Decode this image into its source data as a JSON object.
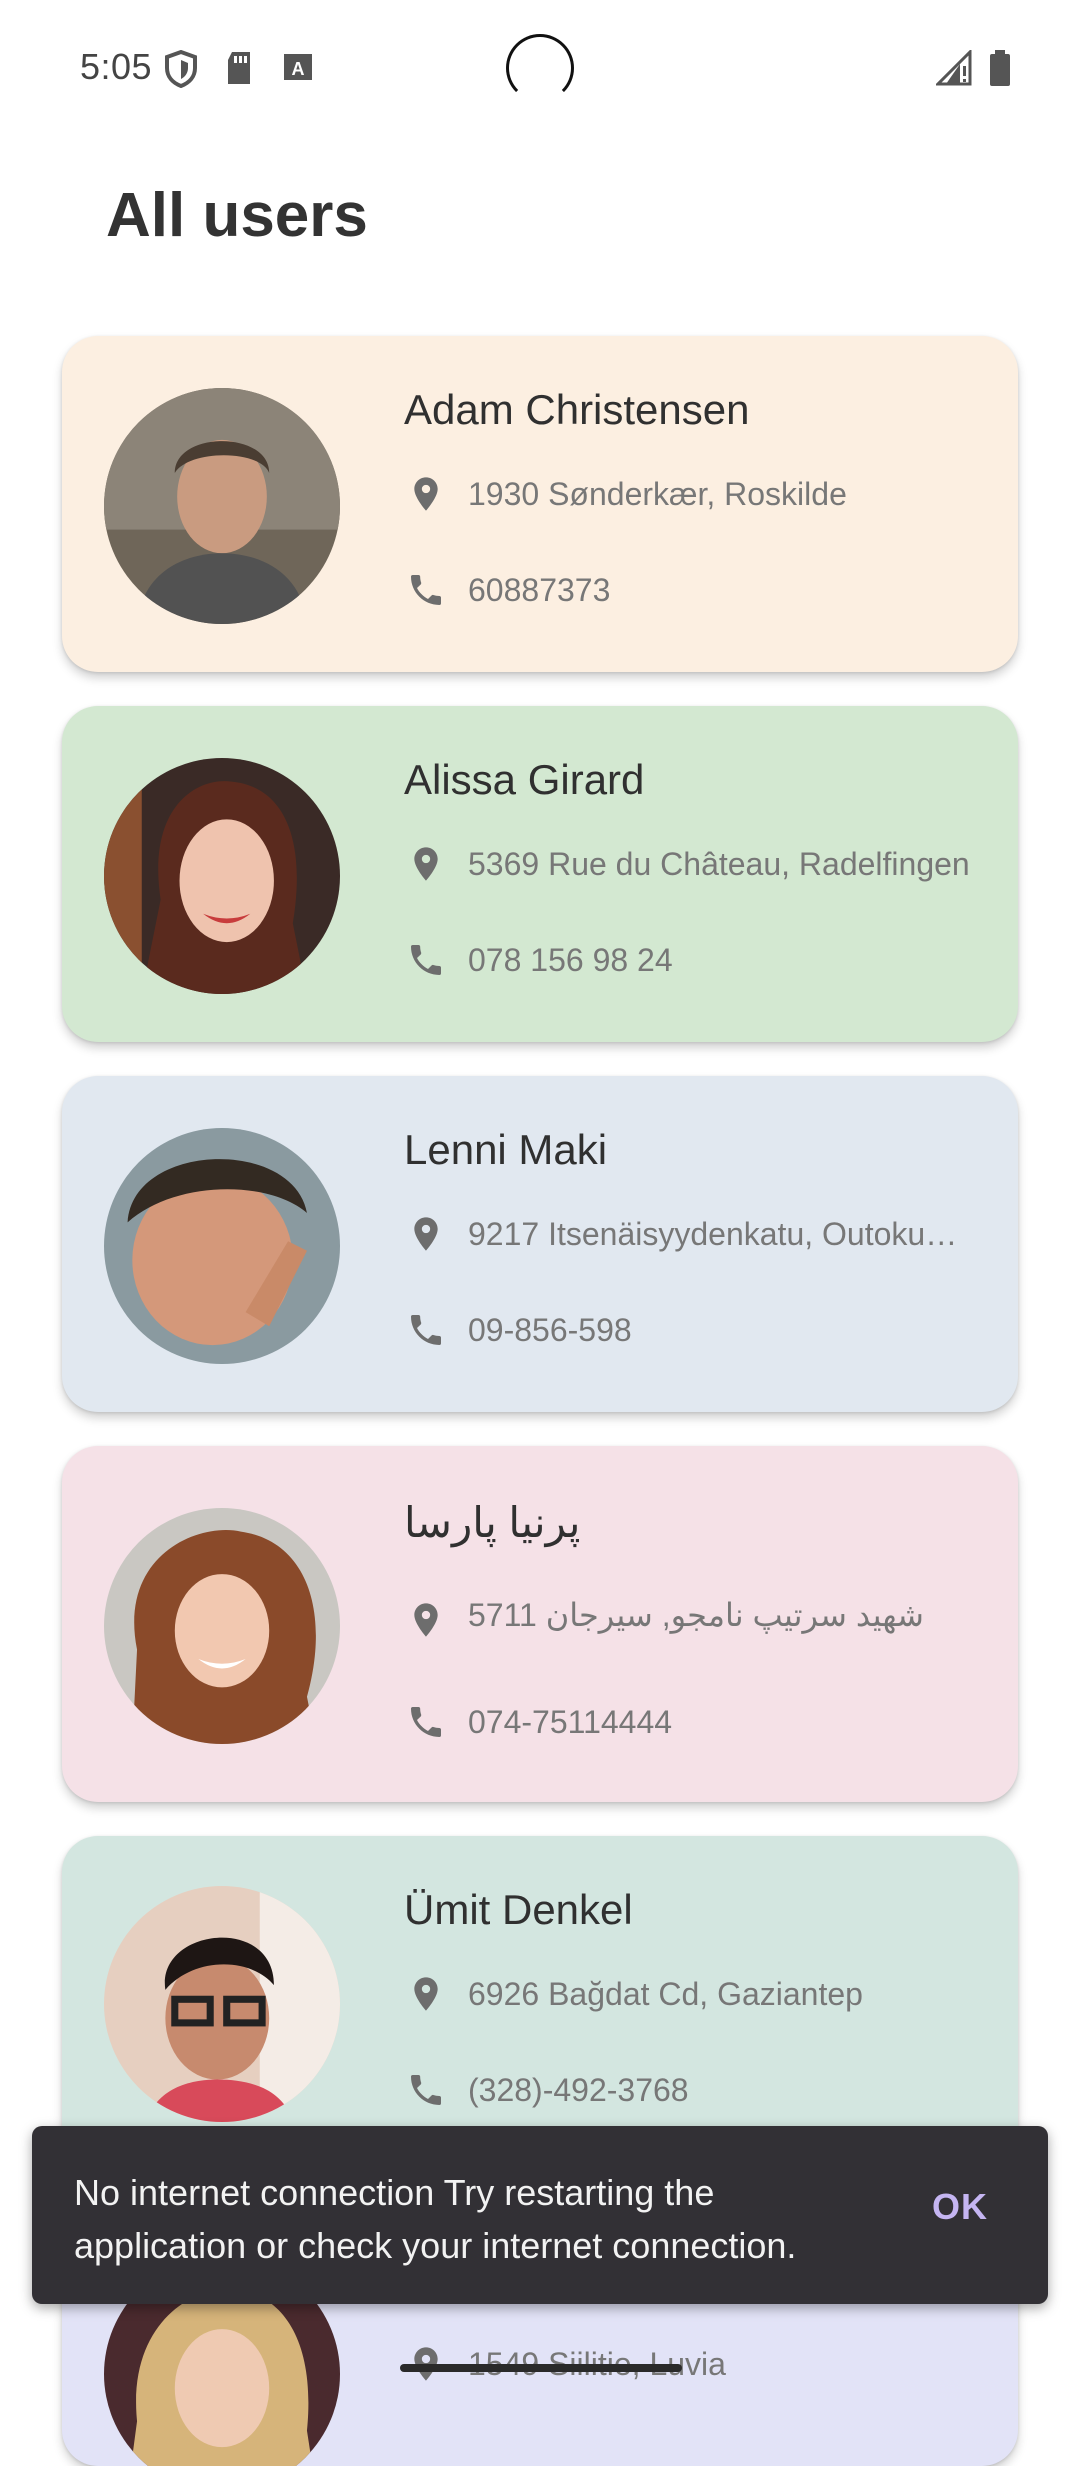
{
  "status_bar": {
    "time": "5:05",
    "icons": [
      "shield-icon",
      "sd-card-icon",
      "keyboard-a-icon",
      "signal-icon",
      "battery-icon"
    ]
  },
  "header": {
    "title": "All users"
  },
  "users": [
    {
      "name": "Adam Christensen",
      "address": "1930 Sønderkær, Roskilde",
      "phone": "60887373",
      "card_color": "#fcefe1"
    },
    {
      "name": "Alissa Girard",
      "address": "5369 Rue du Château, Radelfingen",
      "phone": "078 156 98 24",
      "card_color": "#d3e8d1"
    },
    {
      "name": "Lenni Maki",
      "address": "9217 Itsenäisyydenkatu, Outoku…",
      "phone": "09-856-598",
      "card_color": "#e1e8f0"
    },
    {
      "name": "پرنیا پارسا",
      "address": "5711 شهید سرتیپ نامجو, سیرجان",
      "phone": "074-75114444",
      "card_color": "#f5e1e7"
    },
    {
      "name": "Ümit Denkel",
      "address": "6926 Bağdat Cd, Gaziantep",
      "phone": "(328)-492-3768",
      "card_color": "#d3e6e0"
    },
    {
      "name": "",
      "address": "1549 Siilitie, Luvia",
      "phone": "",
      "card_color": "#e2e3f7"
    }
  ],
  "snackbar": {
    "message": "No internet connection Try restarting the application or check your internet connection.",
    "action": "OK"
  }
}
